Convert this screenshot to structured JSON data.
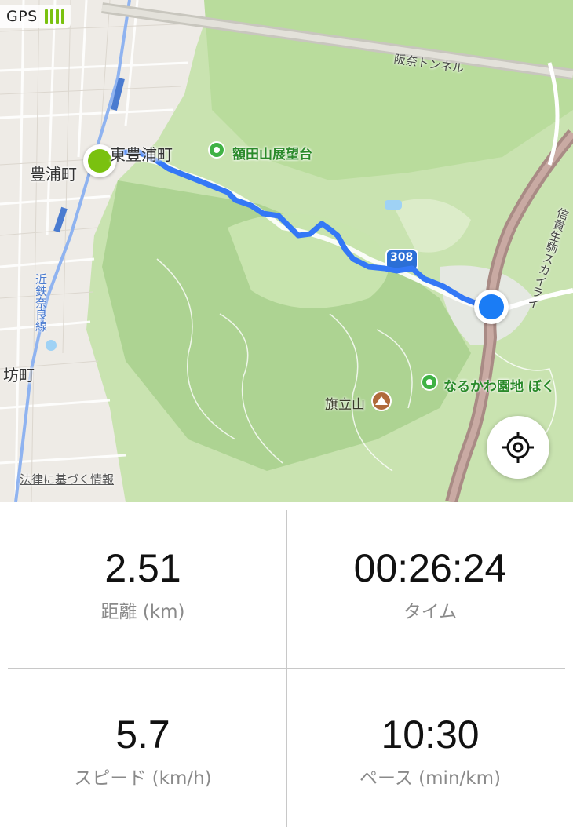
{
  "gps": {
    "label": "GPS",
    "signal_bars": 4,
    "color": "#7ac10f"
  },
  "map": {
    "labels": {
      "toyoura": "豊浦町",
      "higashi_toyoura": "東豊浦町",
      "nukata_observatory": "額田山展望台",
      "hannan_tunnel": "阪奈トンネル",
      "kintetsu_nara": "近鉄奈良線",
      "bo_cho": "坊町",
      "hatatateyama": "旗立山",
      "narukawa": "なるかわ園地 ぼく",
      "shigi_ikoma_skyline": "信貴生駒スカイライ",
      "route_number": "308",
      "legal": "法律に基づく情報"
    },
    "route_color": "#3478f6",
    "start_color": "#7ac10f",
    "current_color": "#1a7cf5",
    "locate_icon": "crosshair-icon"
  },
  "stats": {
    "distance": {
      "value": "2.51",
      "label": "距離 (km)"
    },
    "time": {
      "value": "00:26:24",
      "label": "タイム"
    },
    "speed": {
      "value": "5.7",
      "label": "スピード (km/h)"
    },
    "pace": {
      "value": "10:30",
      "label": "ペース (min/km)"
    }
  }
}
